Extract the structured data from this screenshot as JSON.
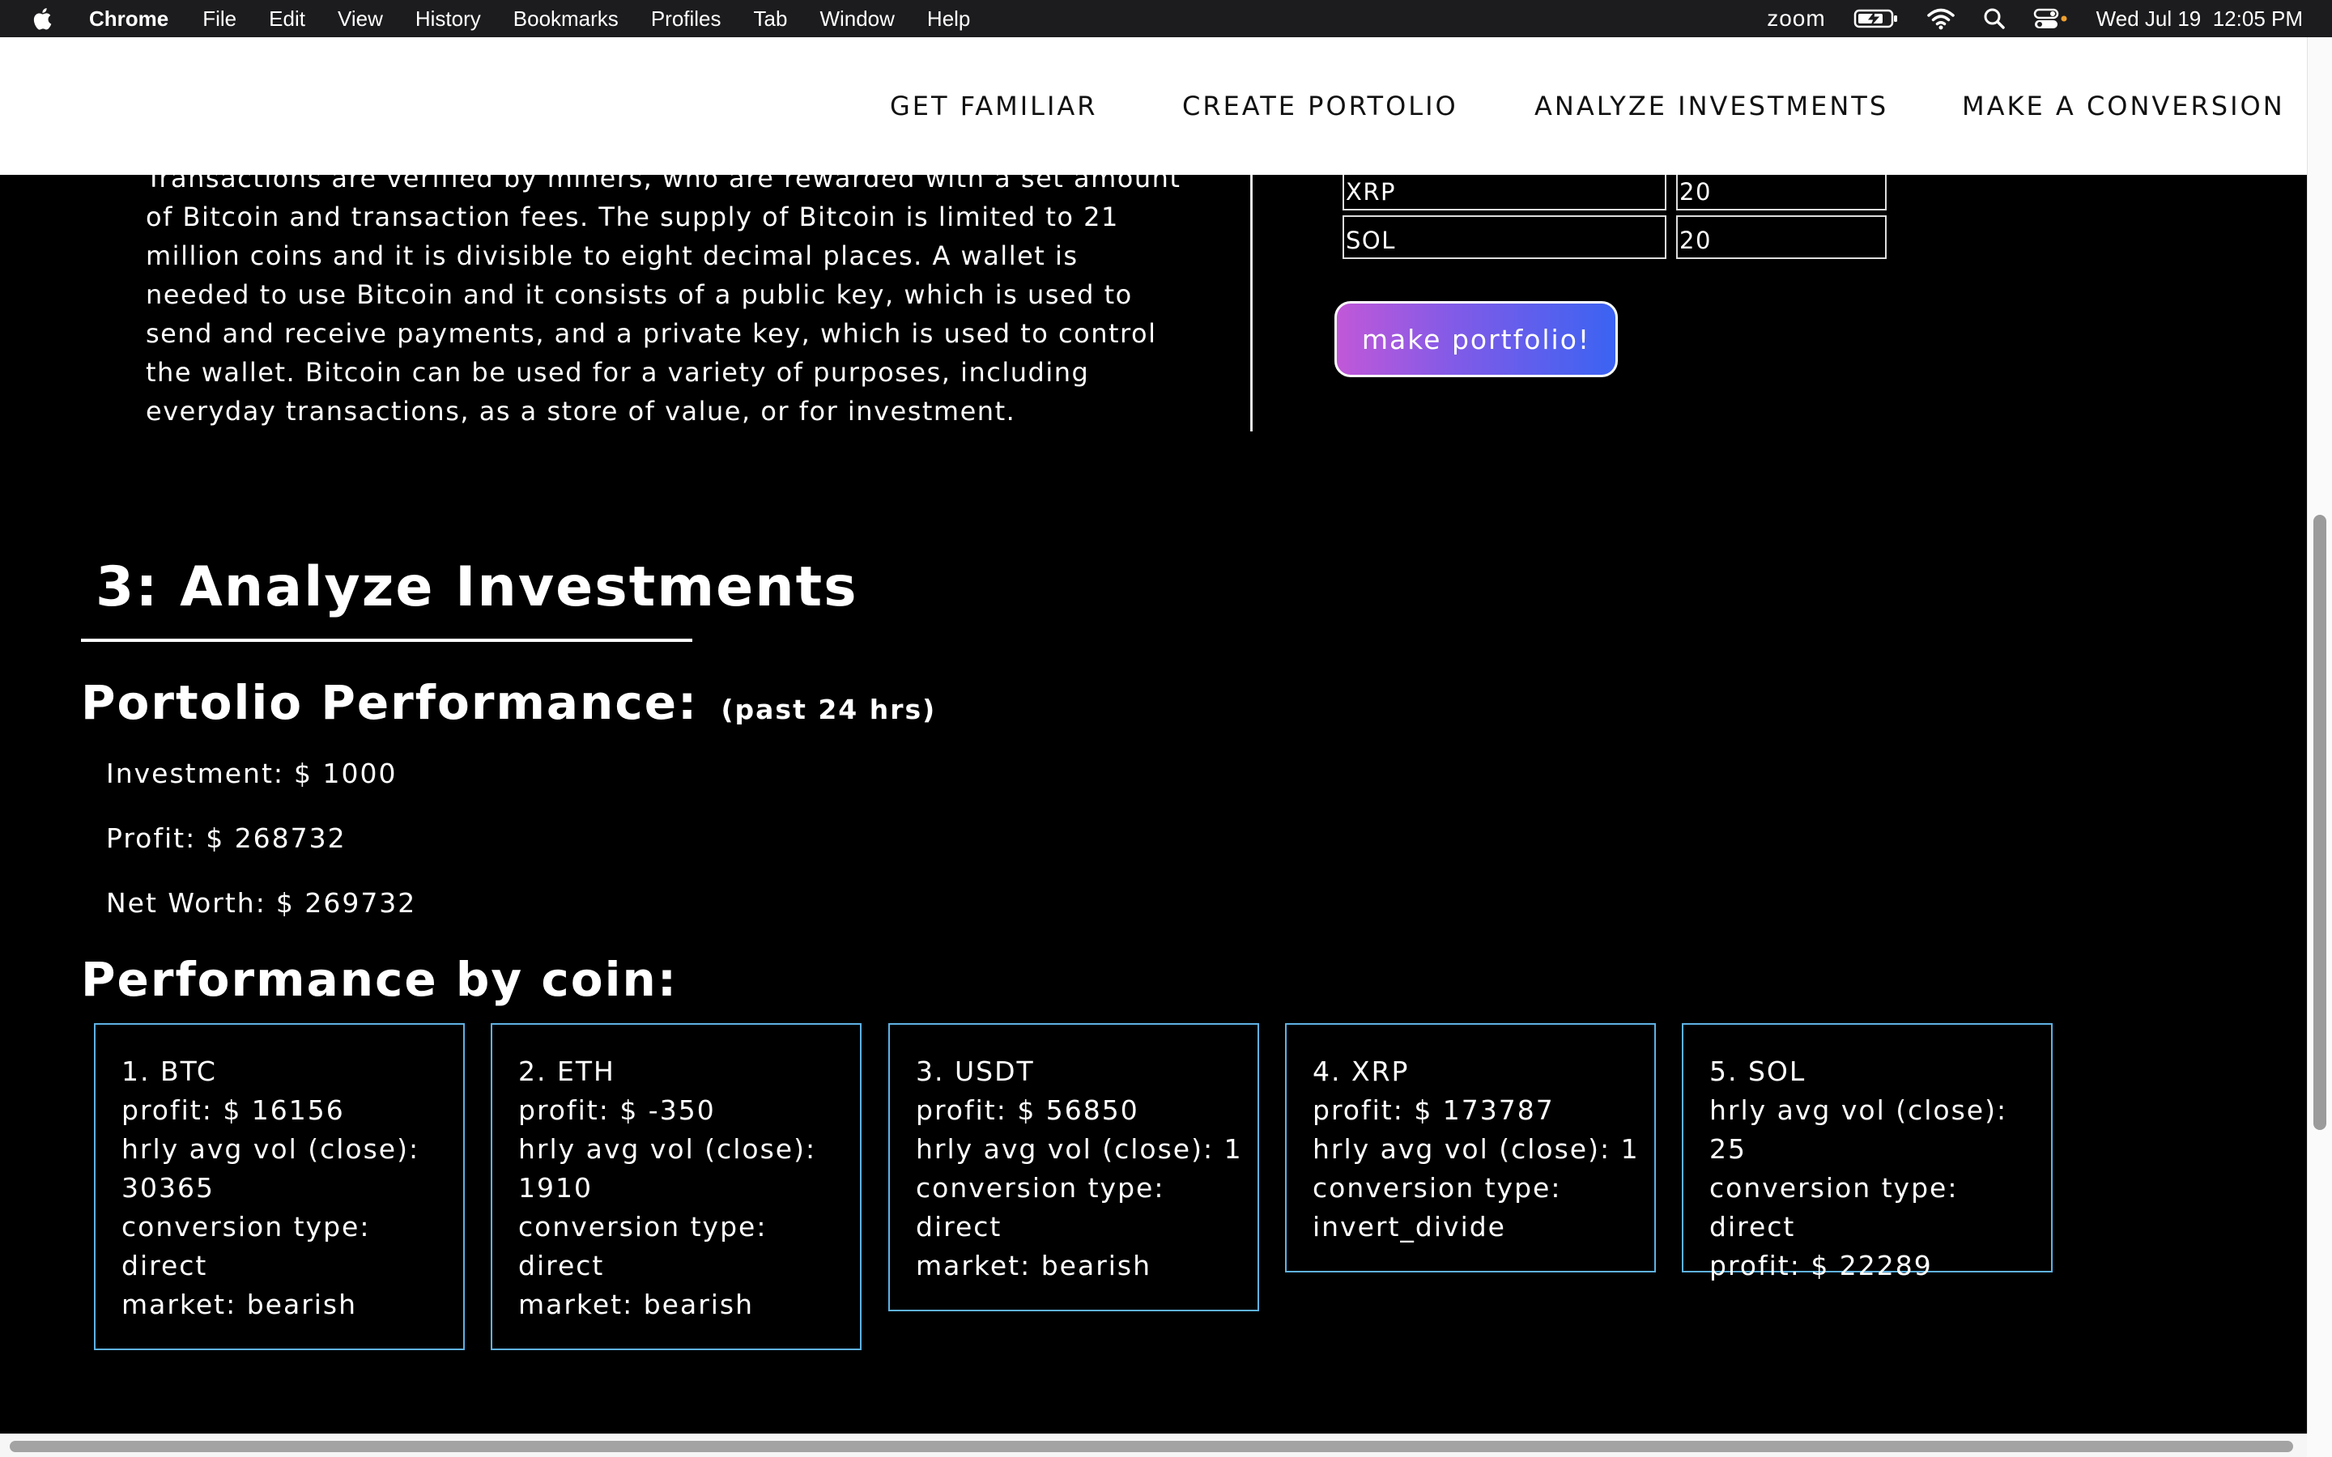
{
  "menubar": {
    "app_name": "Chrome",
    "items": [
      "File",
      "Edit",
      "View",
      "History",
      "Bookmarks",
      "Profiles",
      "Tab",
      "Window",
      "Help"
    ],
    "zoom_label": "zoom",
    "datetime": "Wed Jul 19  12:05 PM"
  },
  "nav": {
    "links": [
      "GET FAMILIAR",
      "CREATE PORTOLIO",
      "ANALYZE INVESTMENTS",
      "MAKE A CONVERSION"
    ]
  },
  "intro": {
    "paragraph": "Transactions are verified by miners, who are rewarded with a set amount of Bitcoin and transaction fees. The supply of Bitcoin is limited to 21 million coins and it is divisible to eight decimal places. A wallet is needed to use Bitcoin and it consists of a public key, which is used to send and receive payments, and a private key, which is used to control the wallet. Bitcoin can be used for a variety of purposes, including everyday transactions, as a store of value, or for investment."
  },
  "portfolio_table": {
    "rows": [
      {
        "symbol": "XRP",
        "amount": "20"
      },
      {
        "symbol": "SOL",
        "amount": "20"
      }
    ]
  },
  "make_portfolio_button": "make portfolio!",
  "analyze": {
    "section_title": "3: Analyze Investments",
    "performance_title": "Portolio Performance:",
    "performance_subtitle": "(past 24 hrs)",
    "investment_label": "Investment:",
    "investment_value": "$ 1000",
    "profit_label": "Profit:",
    "profit_value": "$ 268732",
    "networth_label": "Net Worth:",
    "networth_value": "$ 269732",
    "by_coin_title": "Performance by coin:"
  },
  "coins": [
    {
      "lines": "1. BTC\nprofit: $ 16156\nhrly avg vol (close):\n30365\nconversion type:\ndirect\nmarket: bearish"
    },
    {
      "lines": "2. ETH\nprofit: $ -350\nhrly avg vol (close):\n1910\nconversion type:\ndirect\nmarket: bearish"
    },
    {
      "lines": "3. USDT\nprofit: $ 56850\nhrly avg vol (close): 1\nconversion type:\ndirect\nmarket: bearish"
    },
    {
      "lines": "4. XRP\nprofit: $ 173787\nhrly avg vol (close): 1\nconversion type:\ninvert_divide"
    },
    {
      "lines": "5. SOL\nhrly avg vol (close): 25\nconversion type:\ndirect\nprofit: $ 22289"
    }
  ],
  "colors": {
    "accent_gradient_start": "#c158d8",
    "accent_gradient_end": "#3b63f2",
    "card_border": "#5fb2e5",
    "background": "#000000",
    "nav_background": "#ffffff"
  }
}
